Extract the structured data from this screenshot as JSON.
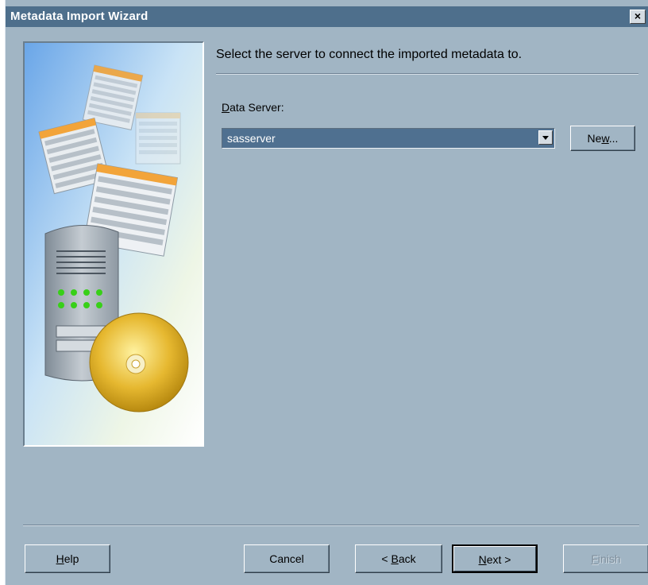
{
  "window": {
    "title": "Metadata Import Wizard",
    "close_label": "×"
  },
  "main": {
    "heading": "Select the server to connect the imported metadata to.",
    "data_server": {
      "label_mnemonic": "D",
      "label_rest": "ata Server:",
      "value": "sasserver"
    },
    "new_button": {
      "prefix": "Ne",
      "mnemonic": "w",
      "suffix": "..."
    }
  },
  "footer": {
    "help": {
      "mnemonic": "H",
      "rest": "elp"
    },
    "cancel": "Cancel",
    "back": {
      "prefix": "< ",
      "mnemonic": "B",
      "rest": "ack"
    },
    "next": {
      "mnemonic": "N",
      "rest": "ext >"
    },
    "finish": {
      "mnemonic": "F",
      "rest": "inish"
    }
  },
  "colors": {
    "dialog_background": "#a1b5c4",
    "titlebar": "#4e6f8c",
    "combo_selected": "#4f7090"
  }
}
